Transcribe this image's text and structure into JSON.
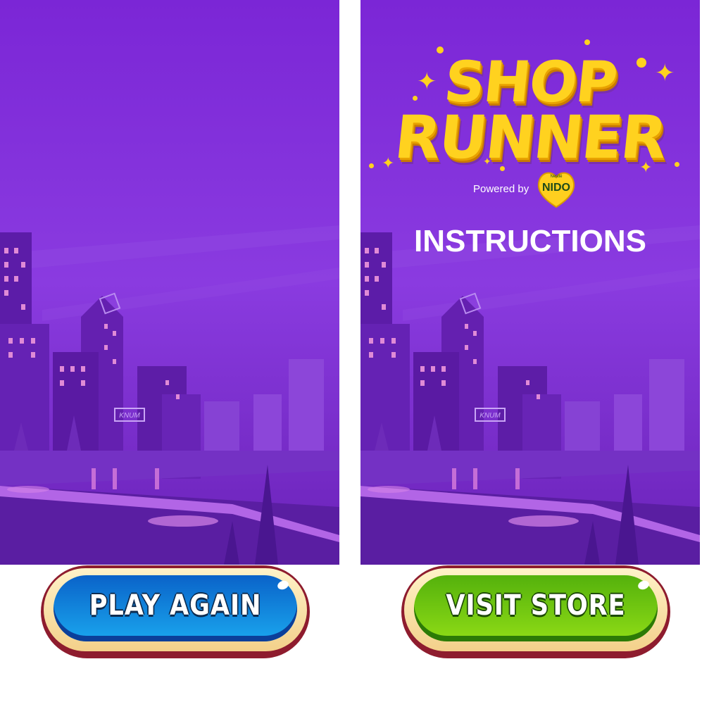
{
  "colors": {
    "sky": "#7b26d6",
    "logo_yellow": "#ffd21f",
    "play_button": "#1aa6ee",
    "visit_button": "#8fdc16",
    "button_border": "#8e1c2e"
  },
  "left_screen": {
    "building_sign": "KNUM"
  },
  "right_screen": {
    "logo": {
      "line1": "SHOP",
      "line2": "RUNNER",
      "powered_by": "Powered by",
      "brand_small": "Nestlé",
      "brand": "NIDO"
    },
    "heading": "INSTRUCTIONS",
    "building_sign": "KNUM"
  },
  "buttons": {
    "play_again": "PLAY AGAIN",
    "visit_store": "VISIT STORE"
  }
}
